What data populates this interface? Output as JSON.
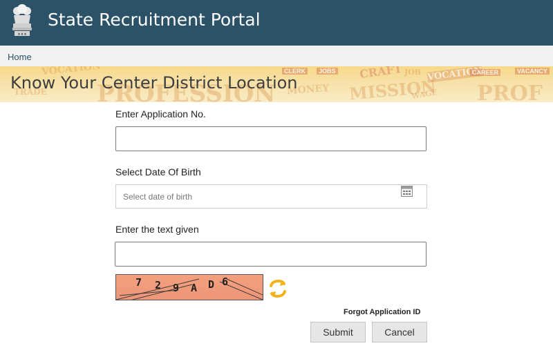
{
  "header": {
    "title": "State Recruitment Portal",
    "emblem_icon": "state-emblem-icon",
    "bg_color": "#2c5268"
  },
  "breadcrumb": {
    "home_label": "Home"
  },
  "banner": {
    "title": "Know Your Center District Location",
    "background_words": [
      "VOCATION",
      "PROFESSION",
      "CLERK",
      "CRAFT",
      "MONEY",
      "MISSION",
      "VOCATION",
      "PROF",
      "CAREER",
      "JOBS",
      "WAGE",
      "JOB",
      "TRADE",
      "VACANCY"
    ]
  },
  "form": {
    "application_no": {
      "label": "Enter Application No.",
      "value": "",
      "placeholder": ""
    },
    "dob": {
      "label": "Select Date Of Birth",
      "value": "",
      "placeholder": "Select date of birth",
      "icon": "calendar-icon"
    },
    "captcha_input": {
      "label": "Enter the text given",
      "value": "",
      "placeholder": ""
    },
    "captcha": {
      "chars": [
        "7",
        "2",
        "9",
        "A",
        "D",
        "6"
      ],
      "bg_color": "#f3a07e",
      "refresh_icon": "refresh-icon"
    },
    "forgot_link": "Forgot Application ID",
    "submit_label": "Submit",
    "cancel_label": "Cancel"
  }
}
